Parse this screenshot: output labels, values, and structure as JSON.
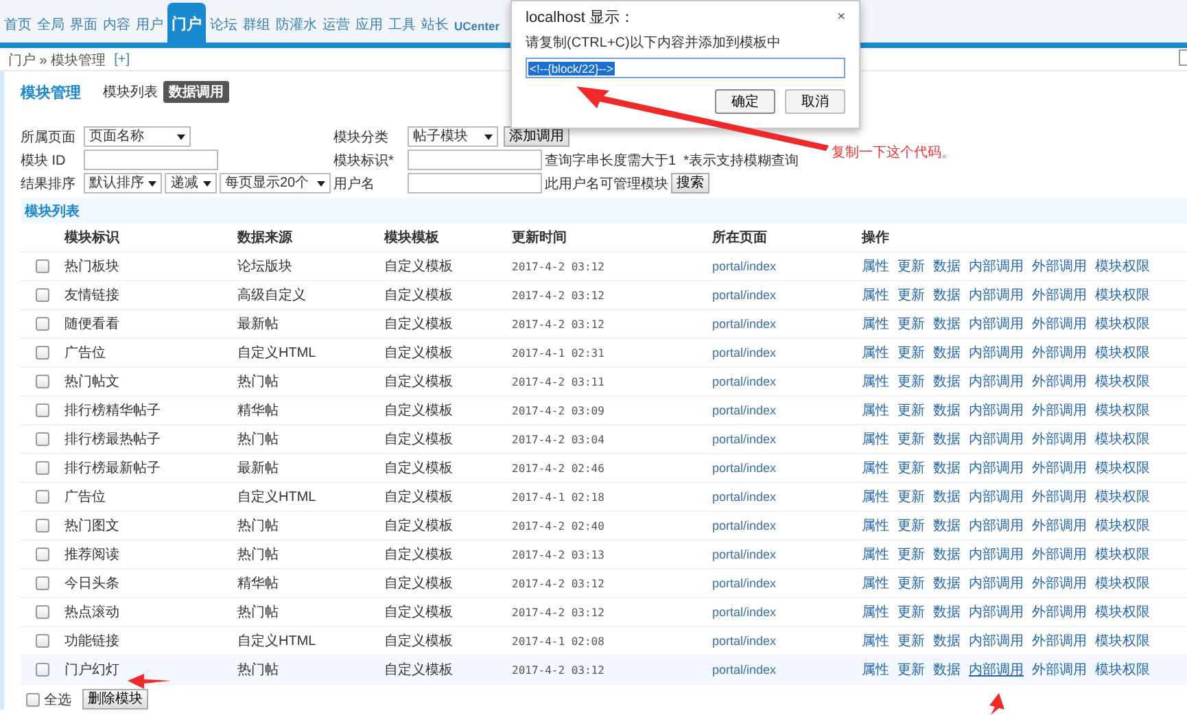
{
  "nav": {
    "items": [
      {
        "label": "首页",
        "selected": false
      },
      {
        "label": "全局",
        "selected": false
      },
      {
        "label": "界面",
        "selected": false
      },
      {
        "label": "内容",
        "selected": false
      },
      {
        "label": "用户",
        "selected": false
      },
      {
        "label": "门户",
        "selected": true
      },
      {
        "label": "论坛",
        "selected": false
      },
      {
        "label": "群组",
        "selected": false
      },
      {
        "label": "防灌水",
        "selected": false
      },
      {
        "label": "运营",
        "selected": false
      },
      {
        "label": "应用",
        "selected": false
      },
      {
        "label": "工具",
        "selected": false
      },
      {
        "label": "站长",
        "selected": false
      },
      {
        "label": "UCenter",
        "selected": false
      }
    ]
  },
  "breadcrumb": {
    "path": "门户 » 模块管理",
    "add": "[+]"
  },
  "header": {
    "title": "模块管理",
    "tabs": [
      {
        "label": "模块列表",
        "selected": false
      },
      {
        "label": "数据调用",
        "selected": true
      }
    ]
  },
  "filters": {
    "page_label": "所属页面",
    "page_select": "页面名称",
    "category_label": "模块分类",
    "category_select": "帖子模块",
    "add_button": "添加调用",
    "id_label": "模块 ID",
    "mark_label": "模块标识*",
    "mark_hint": "查询字串长度需大于1  *表示支持模糊查询",
    "sort_label": "结果排序",
    "sort_select": "默认排序",
    "order_select": "递减",
    "per_page_select": "每页显示20个",
    "user_label": "用户名",
    "user_hint": "此用户名可管理模块",
    "search_button": "搜索"
  },
  "table": {
    "title": "模块列表",
    "columns": [
      "模块标识",
      "数据来源",
      "模块模板",
      "更新时间",
      "所在页面",
      "操作"
    ],
    "rows": [
      {
        "checked": false,
        "highlighted": false,
        "name": "热门板块",
        "source": "论坛版块",
        "template": "自定义模板",
        "time": "2017-4-2 03:12",
        "page": "portal/index",
        "actions": [
          "属性",
          "更新",
          "数据",
          "内部调用",
          "外部调用",
          "模块权限"
        ]
      },
      {
        "checked": false,
        "highlighted": false,
        "name": "友情链接",
        "source": "高级自定义",
        "template": "自定义模板",
        "time": "2017-4-2 03:12",
        "page": "portal/index",
        "actions": [
          "属性",
          "更新",
          "数据",
          "内部调用",
          "外部调用",
          "模块权限"
        ]
      },
      {
        "checked": false,
        "highlighted": false,
        "name": "随便看看",
        "source": "最新帖",
        "template": "自定义模板",
        "time": "2017-4-2 03:12",
        "page": "portal/index",
        "actions": [
          "属性",
          "更新",
          "数据",
          "内部调用",
          "外部调用",
          "模块权限"
        ]
      },
      {
        "checked": false,
        "highlighted": false,
        "name": "广告位",
        "source": "自定义HTML",
        "template": "自定义模板",
        "time": "2017-4-1 02:31",
        "page": "portal/index",
        "actions": [
          "属性",
          "更新",
          "数据",
          "内部调用",
          "外部调用",
          "模块权限"
        ]
      },
      {
        "checked": false,
        "highlighted": false,
        "name": "热门帖文",
        "source": "热门帖",
        "template": "自定义模板",
        "time": "2017-4-2 03:11",
        "page": "portal/index",
        "actions": [
          "属性",
          "更新",
          "数据",
          "内部调用",
          "外部调用",
          "模块权限"
        ]
      },
      {
        "checked": false,
        "highlighted": false,
        "name": "排行榜精华帖子",
        "source": "精华帖",
        "template": "自定义模板",
        "time": "2017-4-2 03:09",
        "page": "portal/index",
        "actions": [
          "属性",
          "更新",
          "数据",
          "内部调用",
          "外部调用",
          "模块权限"
        ]
      },
      {
        "checked": false,
        "highlighted": false,
        "name": "排行榜最热帖子",
        "source": "热门帖",
        "template": "自定义模板",
        "time": "2017-4-2 03:04",
        "page": "portal/index",
        "actions": [
          "属性",
          "更新",
          "数据",
          "内部调用",
          "外部调用",
          "模块权限"
        ]
      },
      {
        "checked": false,
        "highlighted": false,
        "name": "排行榜最新帖子",
        "source": "最新帖",
        "template": "自定义模板",
        "time": "2017-4-2 02:46",
        "page": "portal/index",
        "actions": [
          "属性",
          "更新",
          "数据",
          "内部调用",
          "外部调用",
          "模块权限"
        ]
      },
      {
        "checked": false,
        "highlighted": false,
        "name": "广告位",
        "source": "自定义HTML",
        "template": "自定义模板",
        "time": "2017-4-1 02:18",
        "page": "portal/index",
        "actions": [
          "属性",
          "更新",
          "数据",
          "内部调用",
          "外部调用",
          "模块权限"
        ]
      },
      {
        "checked": false,
        "highlighted": false,
        "name": "热门图文",
        "source": "热门帖",
        "template": "自定义模板",
        "time": "2017-4-2 02:40",
        "page": "portal/index",
        "actions": [
          "属性",
          "更新",
          "数据",
          "内部调用",
          "外部调用",
          "模块权限"
        ]
      },
      {
        "checked": false,
        "highlighted": false,
        "name": "推荐阅读",
        "source": "热门帖",
        "template": "自定义模板",
        "time": "2017-4-2 03:13",
        "page": "portal/index",
        "actions": [
          "属性",
          "更新",
          "数据",
          "内部调用",
          "外部调用",
          "模块权限"
        ]
      },
      {
        "checked": false,
        "highlighted": false,
        "name": "今日头条",
        "source": "精华帖",
        "template": "自定义模板",
        "time": "2017-4-2 03:12",
        "page": "portal/index",
        "actions": [
          "属性",
          "更新",
          "数据",
          "内部调用",
          "外部调用",
          "模块权限"
        ]
      },
      {
        "checked": false,
        "highlighted": false,
        "name": "热点滚动",
        "source": "热门帖",
        "template": "自定义模板",
        "time": "2017-4-2 03:12",
        "page": "portal/index",
        "actions": [
          "属性",
          "更新",
          "数据",
          "内部调用",
          "外部调用",
          "模块权限"
        ]
      },
      {
        "checked": false,
        "highlighted": false,
        "name": "功能链接",
        "source": "自定义HTML",
        "template": "自定义模板",
        "time": "2017-4-1 02:08",
        "page": "portal/index",
        "actions": [
          "属性",
          "更新",
          "数据",
          "内部调用",
          "外部调用",
          "模块权限"
        ]
      },
      {
        "checked": false,
        "highlighted": true,
        "name": "门户幻灯",
        "source": "热门帖",
        "template": "自定义模板",
        "time": "2017-4-2 03:12",
        "page": "portal/index",
        "actions": [
          "属性",
          "更新",
          "数据",
          "内部调用",
          "外部调用",
          "模块权限"
        ]
      }
    ]
  },
  "footer": {
    "select_all": {
      "label": "全选",
      "checked": false
    },
    "delete_button": "删除模块"
  },
  "dialog": {
    "title": "localhost 显示：",
    "close": "×",
    "message": "请复制(CTRL+C)以下内容并添加到模板中",
    "value": "<!--{block/22}-->",
    "value_selected": true,
    "buttons": [
      "确定",
      "取消"
    ]
  },
  "annotation": "复制一下这个代码。"
}
